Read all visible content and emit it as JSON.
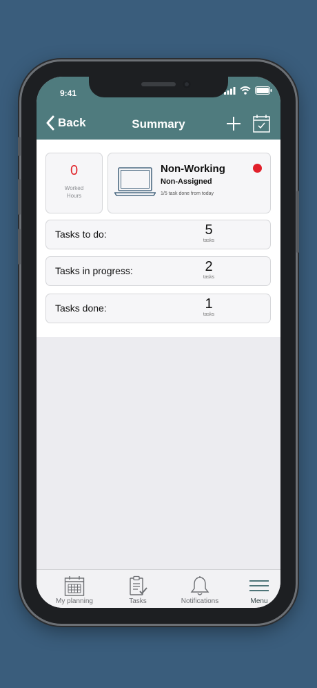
{
  "status_bar": {
    "time": "9:41"
  },
  "nav": {
    "back_label": "Back",
    "title": "Summary",
    "add_icon": "plus-icon",
    "calendar_icon": "calendar-check-icon"
  },
  "hours": {
    "value": "0",
    "label_line1": "Worked",
    "label_line2": "Hours"
  },
  "status": {
    "title": "Non-Working",
    "subtitle": "Non-Assigned",
    "note": "1/5 task done from today",
    "indicator_color": "#e1202b"
  },
  "tasks": [
    {
      "label": "Tasks to do:",
      "count": "5",
      "unit": "tasks"
    },
    {
      "label": "Tasks in progress:",
      "count": "2",
      "unit": "tasks"
    },
    {
      "label": "Tasks done:",
      "count": "1",
      "unit": "tasks"
    }
  ],
  "tabbar": [
    {
      "label": "My planning",
      "icon": "calendar-grid-icon"
    },
    {
      "label": "Tasks",
      "icon": "clipboard-check-icon"
    },
    {
      "label": "Notifications",
      "icon": "bell-icon"
    },
    {
      "label": "Menu",
      "icon": "hamburger-menu-icon"
    }
  ],
  "colors": {
    "background": "#3a5d7c",
    "header": "#4f7b7e",
    "accent_red": "#e1262c"
  }
}
